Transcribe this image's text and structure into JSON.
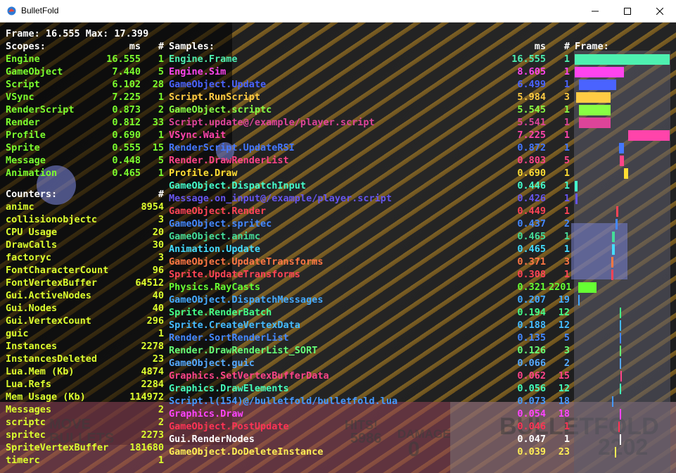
{
  "window": {
    "title": "BulletFold",
    "minimize_icon": "minimize-icon",
    "maximize_icon": "maximize-icon",
    "close_icon": "close-icon"
  },
  "header": {
    "frame_line": "Frame: 16.555 Max: 17.399"
  },
  "scopes": {
    "title": "Scopes:",
    "ms_header": "ms",
    "count_header": "#",
    "rows": [
      {
        "name": "Engine",
        "ms": "16.555",
        "count": "1"
      },
      {
        "name": "GameObject",
        "ms": "7.440",
        "count": "5"
      },
      {
        "name": "Script",
        "ms": "6.102",
        "count": "28"
      },
      {
        "name": "VSync",
        "ms": "7.225",
        "count": "1"
      },
      {
        "name": "RenderScript",
        "ms": "0.873",
        "count": "2"
      },
      {
        "name": "Render",
        "ms": "0.812",
        "count": "33"
      },
      {
        "name": "Profile",
        "ms": "0.690",
        "count": "1"
      },
      {
        "name": "Sprite",
        "ms": "0.555",
        "count": "15"
      },
      {
        "name": "Message",
        "ms": "0.448",
        "count": "5"
      },
      {
        "name": "Animation",
        "ms": "0.465",
        "count": "1"
      }
    ]
  },
  "counters": {
    "title": "Counters:",
    "count_header": "#",
    "rows": [
      {
        "name": "animc",
        "value": "8954"
      },
      {
        "name": "collisionobjectc",
        "value": "3"
      },
      {
        "name": "CPU Usage",
        "value": "20"
      },
      {
        "name": "DrawCalls",
        "value": "30"
      },
      {
        "name": "factoryc",
        "value": "3"
      },
      {
        "name": "FontCharacterCount",
        "value": "96"
      },
      {
        "name": "FontVertexBuffer",
        "value": "64512"
      },
      {
        "name": "Gui.ActiveNodes",
        "value": "40"
      },
      {
        "name": "Gui.Nodes",
        "value": "40"
      },
      {
        "name": "Gui.VertexCount",
        "value": "296"
      },
      {
        "name": "guic",
        "value": "1"
      },
      {
        "name": "Instances",
        "value": "2278"
      },
      {
        "name": "InstancesDeleted",
        "value": "23"
      },
      {
        "name": "Lua.Mem (Kb)",
        "value": "4874"
      },
      {
        "name": "Lua.Refs",
        "value": "2284"
      },
      {
        "name": "Mem Usage (Kb)",
        "value": "114972"
      },
      {
        "name": "Messages",
        "value": "2"
      },
      {
        "name": "scriptc",
        "value": "2"
      },
      {
        "name": "spritec",
        "value": "2273"
      },
      {
        "name": "SpriteVertexBuffer",
        "value": "181680"
      },
      {
        "name": "timerc",
        "value": "1"
      }
    ]
  },
  "samples": {
    "title": "Samples:",
    "ms_header": "ms",
    "count_header": "#",
    "frame_header": "Frame:",
    "rows": [
      {
        "name": "Engine.Frame",
        "ms": "16.555",
        "count": "1",
        "color": "#4ef0b0",
        "start": 0.0,
        "duration": 16.555
      },
      {
        "name": "Engine.Sim",
        "ms": "8.605",
        "count": "1",
        "color": "#ff44ee",
        "start": 0.0,
        "duration": 8.605
      },
      {
        "name": "GameObject.Update",
        "ms": "6.499",
        "count": "1",
        "color": "#4a63ff",
        "start": 0.7,
        "duration": 6.499
      },
      {
        "name": "Script.RunScript",
        "ms": "5.984",
        "count": "3",
        "color": "#ffcc44",
        "start": 0.3,
        "duration": 5.984
      },
      {
        "name": "GameObject.scriptc",
        "ms": "5.545",
        "count": "1",
        "color": "#88ff44",
        "start": 0.7,
        "duration": 5.545
      },
      {
        "name": "Script.update@/example/player.script",
        "ms": "5.541",
        "count": "1",
        "color": "#dd4499",
        "start": 0.7,
        "duration": 5.541
      },
      {
        "name": "VSync.Wait",
        "ms": "7.225",
        "count": "1",
        "color": "#ff44aa",
        "start": 9.33,
        "duration": 7.225
      },
      {
        "name": "RenderScript.UpdateRSI",
        "ms": "0.872",
        "count": "1",
        "color": "#4477ff",
        "start": 7.7,
        "duration": 0.872
      },
      {
        "name": "Render.DrawRenderList",
        "ms": "0.803",
        "count": "5",
        "color": "#ff4488",
        "start": 7.8,
        "duration": 0.803
      },
      {
        "name": "Profile.Draw",
        "ms": "0.690",
        "count": "1",
        "color": "#ffdd33",
        "start": 8.6,
        "duration": 0.69
      },
      {
        "name": "GameObject.DispatchInput",
        "ms": "0.446",
        "count": "1",
        "color": "#44ffcc",
        "start": 0.05,
        "duration": 0.446
      },
      {
        "name": "Message.on_input@/example/player.script",
        "ms": "0.426",
        "count": "1",
        "color": "#6655ee",
        "start": 0.1,
        "duration": 0.426
      },
      {
        "name": "GameObject.Render",
        "ms": "0.449",
        "count": "1",
        "color": "#ff4455",
        "start": 7.2,
        "duration": 0.449
      },
      {
        "name": "GameObject.spritec",
        "ms": "0.437",
        "count": "2",
        "color": "#4488ff",
        "start": 7.1,
        "duration": 0.437
      },
      {
        "name": "GameObject.animc",
        "ms": "0.465",
        "count": "1",
        "color": "#44dd99",
        "start": 6.5,
        "duration": 0.465
      },
      {
        "name": "Animation.Update",
        "ms": "0.465",
        "count": "1",
        "color": "#44ddff",
        "start": 6.5,
        "duration": 0.465
      },
      {
        "name": "GameObject.UpdateTransforms",
        "ms": "0.371",
        "count": "3",
        "color": "#ff7744",
        "start": 6.4,
        "duration": 0.371
      },
      {
        "name": "Sprite.UpdateTransforms",
        "ms": "0.308",
        "count": "1",
        "color": "#ff4455",
        "start": 6.4,
        "duration": 0.308
      },
      {
        "name": "Physics.RayCasts",
        "ms": "0.321",
        "count": "2201",
        "color": "#66ff33",
        "start": 0.6,
        "duration": 3.2
      },
      {
        "name": "GameObject.DispatchMessages",
        "ms": "0.207",
        "count": "19",
        "color": "#44aaff",
        "start": 0.6,
        "duration": 0.207
      },
      {
        "name": "Sprite.RenderBatch",
        "ms": "0.194",
        "count": "12",
        "color": "#44ff88",
        "start": 7.9,
        "duration": 0.194
      },
      {
        "name": "Sprite.CreateVertexData",
        "ms": "0.188",
        "count": "12",
        "color": "#44bbff",
        "start": 7.9,
        "duration": 0.188
      },
      {
        "name": "Render.SortRenderList",
        "ms": "0.135",
        "count": "5",
        "color": "#4488ff",
        "start": 7.8,
        "duration": 0.135
      },
      {
        "name": "Render.DrawRenderList_SORT",
        "ms": "0.126",
        "count": "3",
        "color": "#66ff77",
        "start": 7.8,
        "duration": 0.126
      },
      {
        "name": "GameObject.guic",
        "ms": "0.066",
        "count": "2",
        "color": "#55aaff",
        "start": 7.8,
        "duration": 0.066
      },
      {
        "name": "Graphics.SetVertexBufferData",
        "ms": "0.062",
        "count": "15",
        "color": "#ff4488",
        "start": 8.0,
        "duration": 0.062
      },
      {
        "name": "Graphics.DrawElements",
        "ms": "0.056",
        "count": "12",
        "color": "#44ffbb",
        "start": 7.9,
        "duration": 0.056
      },
      {
        "name": "Script.l(154)@/bulletfold/bulletfold.lua",
        "ms": "0.073",
        "count": "18",
        "color": "#4499ff",
        "start": 6.5,
        "duration": 0.073
      },
      {
        "name": "Graphics.Draw",
        "ms": "0.054",
        "count": "18",
        "color": "#ff44ff",
        "start": 7.9,
        "duration": 0.054
      },
      {
        "name": "GameObject.PostUpdate",
        "ms": "0.046",
        "count": "1",
        "color": "#ff3355",
        "start": 7.6,
        "duration": 0.046
      },
      {
        "name": "Gui.RenderNodes",
        "ms": "0.047",
        "count": "1",
        "color": "#ffffff",
        "start": 7.8,
        "duration": 0.047
      },
      {
        "name": "GameObject.DoDeleteInstance",
        "ms": "0.039",
        "count": "23",
        "color": "#ffee55",
        "start": 7.0,
        "duration": 0.039
      }
    ]
  },
  "colors": {
    "scopes": "#7cff2e",
    "counters": "#dcff2e",
    "header": "#ffffff"
  }
}
